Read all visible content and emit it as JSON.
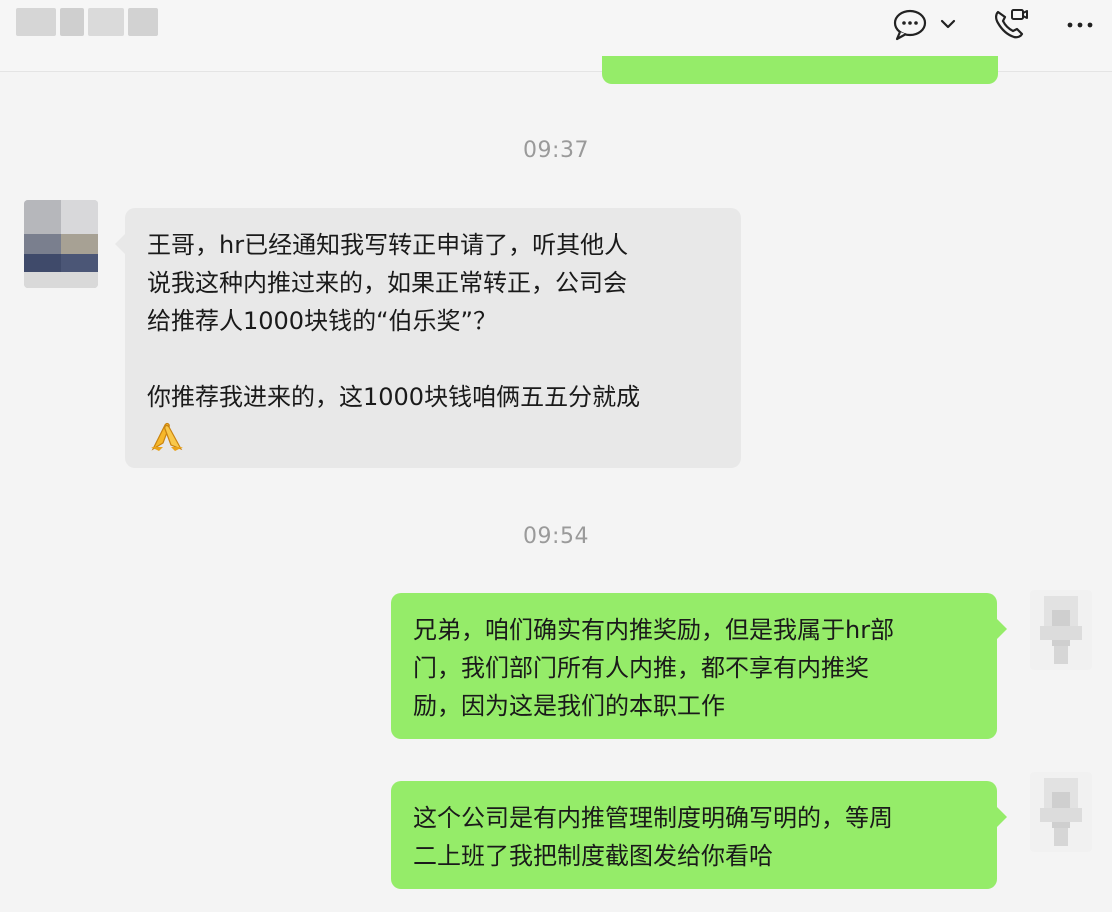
{
  "header": {
    "contact_name_icon": "blurred-name",
    "icons": [
      "chat-bubble-icon",
      "chevron-down-icon",
      "phone-video-icon",
      "more-icon"
    ]
  },
  "messages": [
    {
      "type": "timestamp",
      "text": "09:37"
    },
    {
      "type": "incoming",
      "lines": [
        "王哥，hr已经通知我写转正申请了，听其他人",
        "说我这种内推过来的，如果正常转正，公司会",
        "给推荐人1000块钱的“伯乐奖”？",
        "",
        "你推荐我进来的，这1000块钱咱俩五五分就成"
      ],
      "emoji": "folded-hands-emoji"
    },
    {
      "type": "timestamp",
      "text": "09:54"
    },
    {
      "type": "outgoing",
      "lines": [
        "兄弟，咱们确实有内推奖励，但是我属于hr部",
        "门，我们部门所有人内推，都不享有内推奖",
        "励，因为这是我们的本职工作"
      ]
    },
    {
      "type": "outgoing",
      "lines": [
        "这个公司是有内推管理制度明确写明的，等周",
        "二上班了我把制度截图发给你看哈"
      ]
    }
  ],
  "colors": {
    "incoming_bubble": "#e8e8e8",
    "outgoing_bubble": "#95ec69",
    "timestamp": "#9a9a9a",
    "background": "#f4f4f4"
  }
}
